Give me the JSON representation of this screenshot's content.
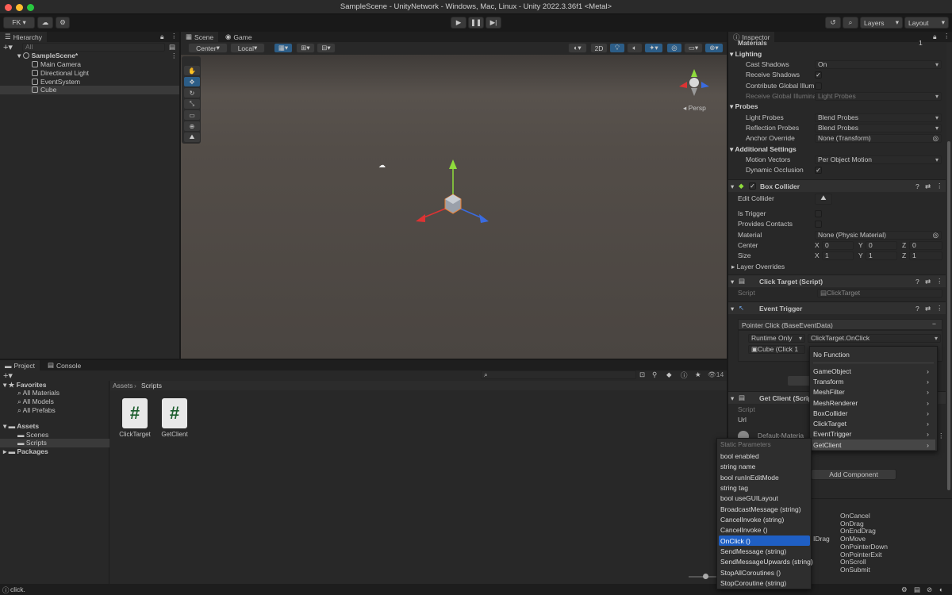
{
  "window": {
    "title": "SampleScene - UnityNetwork - Windows, Mac, Linux - Unity 2022.3.36f1 <Metal>"
  },
  "toolbar": {
    "account": "FK ▾",
    "play": "▶",
    "pause": "❚❚",
    "step": "▶|",
    "layers": "Layers",
    "layout": "Layout"
  },
  "hierarchy": {
    "tab": "Hierarchy",
    "search_placeholder": "All",
    "scene": "SampleScene*",
    "items": [
      "Main Camera",
      "Directional Light",
      "EventSystem",
      "Cube"
    ]
  },
  "scene": {
    "tabs": [
      "Scene",
      "Game"
    ],
    "pivot": "Center",
    "space": "Local",
    "mode2d": "2D",
    "persp": "Persp"
  },
  "project": {
    "tabs": [
      "Project",
      "Console"
    ],
    "favorites": "Favorites",
    "fav_items": [
      "All Materials",
      "All Models",
      "All Prefabs"
    ],
    "assets": "Assets",
    "asset_items": [
      "Scenes",
      "Scripts"
    ],
    "packages": "Packages",
    "breadcrumb": [
      "Assets",
      "Scripts"
    ],
    "files": [
      "ClickTarget",
      "GetClient"
    ],
    "count": "14",
    "status": "click."
  },
  "inspector": {
    "tab": "Inspector",
    "materials_label": "Materials",
    "materials_count": "1",
    "lighting": "Lighting",
    "cast_shadows_label": "Cast Shadows",
    "cast_shadows": "On",
    "receive_shadows_label": "Receive Shadows",
    "contribute_gi_label": "Contribute Global Illumi",
    "receive_gi_label": "Receive Global Illuminat",
    "receive_gi": "Light Probes",
    "probes": "Probes",
    "light_probes_label": "Light Probes",
    "light_probes": "Blend Probes",
    "reflection_probes_label": "Reflection Probes",
    "reflection_probes": "Blend Probes",
    "anchor_label": "Anchor Override",
    "anchor": "None (Transform)",
    "additional": "Additional Settings",
    "motion_label": "Motion Vectors",
    "motion": "Per Object Motion",
    "dynocc_label": "Dynamic Occlusion",
    "box_collider": "Box Collider",
    "edit_collider": "Edit Collider",
    "is_trigger": "Is Trigger",
    "provides_contacts": "Provides Contacts",
    "material_label": "Material",
    "material": "None (Physic Material)",
    "center_label": "Center",
    "size_label": "Size",
    "center": [
      "0",
      "0",
      "0"
    ],
    "size": [
      "1",
      "1",
      "1"
    ],
    "layer_overrides": "Layer Overrides",
    "click_target": "Click Target (Script)",
    "script_label": "Script",
    "click_script": "ClickTarget",
    "event_trigger": "Event Trigger",
    "pointer_click": "Pointer Click (BaseEventData)",
    "runtime": "Runtime Only",
    "function": "ClickTarget.OnClick",
    "object": "Cube (Click 1",
    "get_client": "Get Client (Scrip",
    "script2_label": "Script",
    "url_label": "Url",
    "default_material": "Default-Materia",
    "add_component": "Add Component",
    "event_list": [
      "OnCancel",
      "OnDrag",
      "OnEndDrag",
      "OnMove",
      "OnPointerDown",
      "OnPointerExit",
      "OnScroll",
      "OnSubmit"
    ],
    "idrag": "IDrag"
  },
  "menu1": {
    "items": [
      "No Function",
      "GameObject",
      "Transform",
      "MeshFilter",
      "MeshRenderer",
      "BoxCollider",
      "ClickTarget",
      "EventTrigger",
      "GetClient"
    ]
  },
  "menu2": {
    "header": "Static Parameters",
    "items": [
      "bool enabled",
      "string name",
      "bool runInEditMode",
      "string tag",
      "bool useGUILayout",
      "BroadcastMessage (string)",
      "CancelInvoke (string)",
      "CancelInvoke ()",
      "OnClick ()",
      "SendMessage (string)",
      "SendMessageUpwards (string)",
      "StopAllCoroutines ()",
      "StopCoroutine (string)"
    ],
    "selected": "OnClick ()"
  },
  "colors": {
    "accent": "#2c5d87",
    "selection": "#1f5fc4",
    "scene_bg": "#514b46",
    "panel": "#282828"
  }
}
